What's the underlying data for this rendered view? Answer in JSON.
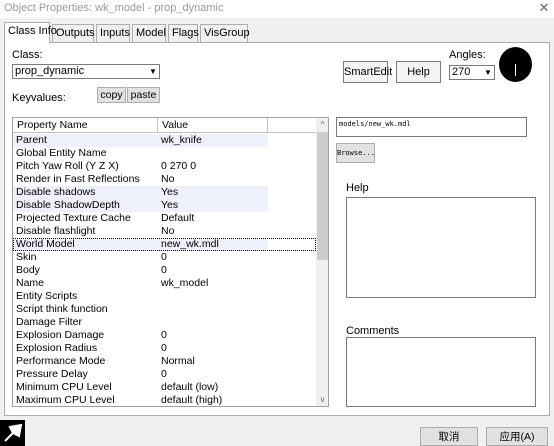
{
  "window": {
    "title": "Object Properties: wk_model - prop_dynamic",
    "close_glyph": "✕"
  },
  "tabs": [
    "Class Info",
    "Outputs",
    "Inputs",
    "Model",
    "Flags",
    "VisGroup"
  ],
  "class_info": {
    "class_label": "Class:",
    "class_value": "prop_dynamic",
    "keyvalues_label": "Keyvalues:",
    "copy_label": "copy",
    "paste_label": "paste",
    "smartedit_label": "SmartEdit",
    "help_button_label": "Help",
    "angles_label": "Angles:",
    "angles_value": "270"
  },
  "grid": {
    "columns": [
      "Property Name",
      "Value"
    ],
    "rows": [
      {
        "name": "Parent",
        "value": "wk_knife"
      },
      {
        "name": "Global Entity Name",
        "value": ""
      },
      {
        "name": "Pitch Yaw Roll (Y Z X)",
        "value": "0 270 0"
      },
      {
        "name": "Render in Fast Reflections",
        "value": "No"
      },
      {
        "name": "Disable shadows",
        "value": "Yes"
      },
      {
        "name": "Disable ShadowDepth",
        "value": "Yes"
      },
      {
        "name": "Projected Texture Cache",
        "value": "Default"
      },
      {
        "name": "Disable flashlight",
        "value": "No"
      },
      {
        "name": "World Model",
        "value": "new_wk.mdl"
      },
      {
        "name": "Skin",
        "value": "0"
      },
      {
        "name": "Body",
        "value": "0"
      },
      {
        "name": "Name",
        "value": "wk_model"
      },
      {
        "name": "Entity Scripts",
        "value": ""
      },
      {
        "name": "Script think function",
        "value": ""
      },
      {
        "name": "Damage Filter",
        "value": ""
      },
      {
        "name": "Explosion Damage",
        "value": "0"
      },
      {
        "name": "Explosion Radius",
        "value": "0"
      },
      {
        "name": "Performance Mode",
        "value": "Normal"
      },
      {
        "name": "Pressure Delay",
        "value": "0"
      },
      {
        "name": "Minimum CPU Level",
        "value": "default (low)"
      },
      {
        "name": "Maximum CPU Level",
        "value": "default (high)"
      }
    ],
    "scroll_up_glyph": "^",
    "scroll_down_glyph": "v"
  },
  "editor": {
    "model_path": "models/new_wk.mdl",
    "browse_label": "Browse...",
    "help_label": "Help",
    "comments_label": "Comments"
  },
  "footer": {
    "cancel_label": "取消",
    "apply_label": "应用(A)"
  },
  "icons": {
    "dropdown": "chevron-down-icon",
    "angle": "angle-dial-icon",
    "picker": "pick-arrow-icon"
  }
}
